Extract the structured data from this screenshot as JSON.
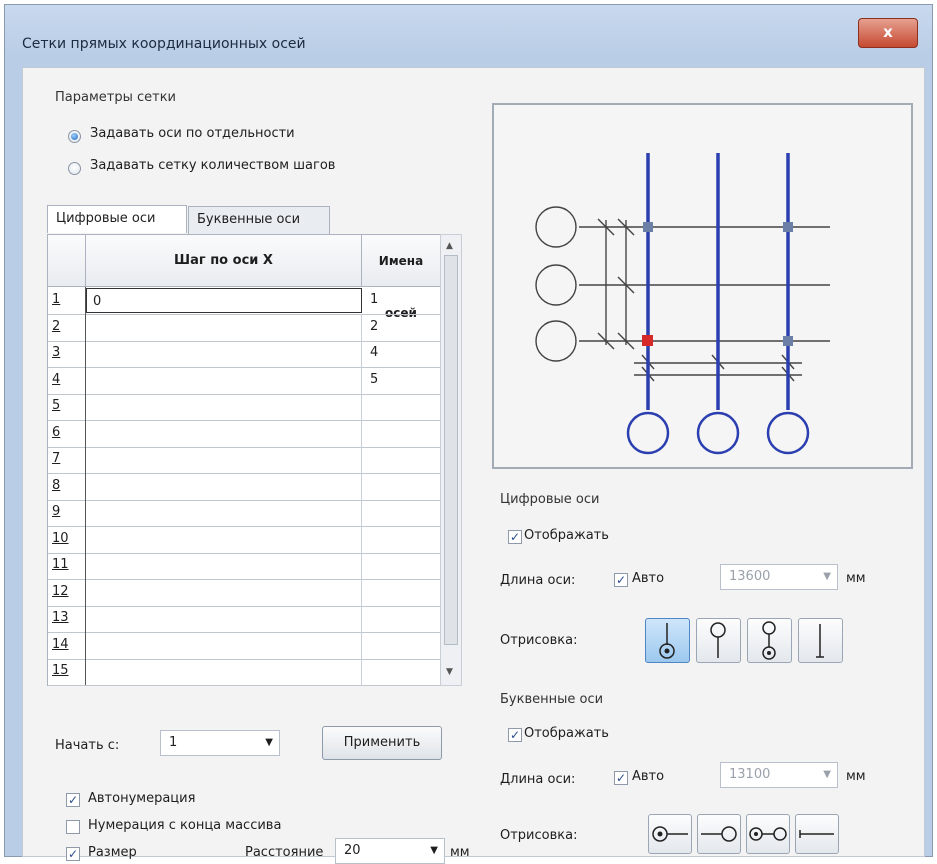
{
  "window": {
    "title": "Сетки прямых координационных осей",
    "close_glyph": "x"
  },
  "grid_params": {
    "group_label": "Параметры сетки",
    "radio_separate": "Задавать оси по отдельности",
    "radio_steps": "Задавать сетку количеством шагов",
    "selected": "separate"
  },
  "tabs": [
    "Цифровые оси",
    "Буквенные оси"
  ],
  "table": {
    "columns": [
      "Шаг по оси X",
      "Имена осей"
    ],
    "rows": [
      {
        "num": "1",
        "step": "0",
        "name": "1"
      },
      {
        "num": "2",
        "step": "",
        "name": "2"
      },
      {
        "num": "3",
        "step": "",
        "name": "4"
      },
      {
        "num": "4",
        "step": "",
        "name": "5"
      },
      {
        "num": "5",
        "step": "",
        "name": ""
      },
      {
        "num": "6",
        "step": "",
        "name": ""
      },
      {
        "num": "7",
        "step": "",
        "name": ""
      },
      {
        "num": "8",
        "step": "",
        "name": ""
      },
      {
        "num": "9",
        "step": "",
        "name": ""
      },
      {
        "num": "10",
        "step": "",
        "name": ""
      },
      {
        "num": "11",
        "step": "",
        "name": ""
      },
      {
        "num": "12",
        "step": "",
        "name": ""
      },
      {
        "num": "13",
        "step": "",
        "name": ""
      },
      {
        "num": "14",
        "step": "",
        "name": ""
      },
      {
        "num": "15",
        "step": "",
        "name": ""
      }
    ]
  },
  "bottom": {
    "start_label": "Начать с:",
    "start_value": "1",
    "apply_button": "Применить",
    "autonumber": "Автонумерация",
    "autonumber_checked": true,
    "reverse_numbering": "Нумерация с конца массива",
    "reverse_checked": false,
    "show_label": "Размер",
    "show_checked": true,
    "distance_label": "Расстояние",
    "distance_value": "20",
    "distance_unit": "мм"
  },
  "digital_axes": {
    "group_label": "Цифровые оси",
    "show_label": "Отображать",
    "show_checked": true,
    "length_label": "Длина оси:",
    "auto_label": "Авто",
    "auto_checked": true,
    "length_value": "13600",
    "unit": "мм",
    "draw_label": "Отрисовка:",
    "selected_style": 0
  },
  "letter_axes": {
    "group_label": "Буквенные оси",
    "show_label": "Отображать",
    "show_checked": true,
    "length_label": "Длина оси:",
    "auto_label": "Авто",
    "auto_checked": true,
    "length_value": "13100",
    "unit": "мм",
    "draw_label": "Отрисовка:"
  },
  "colors": {
    "axis_blue": "#2b3fb0",
    "marker_red": "#d62a2a",
    "line_gray": "#444444"
  }
}
